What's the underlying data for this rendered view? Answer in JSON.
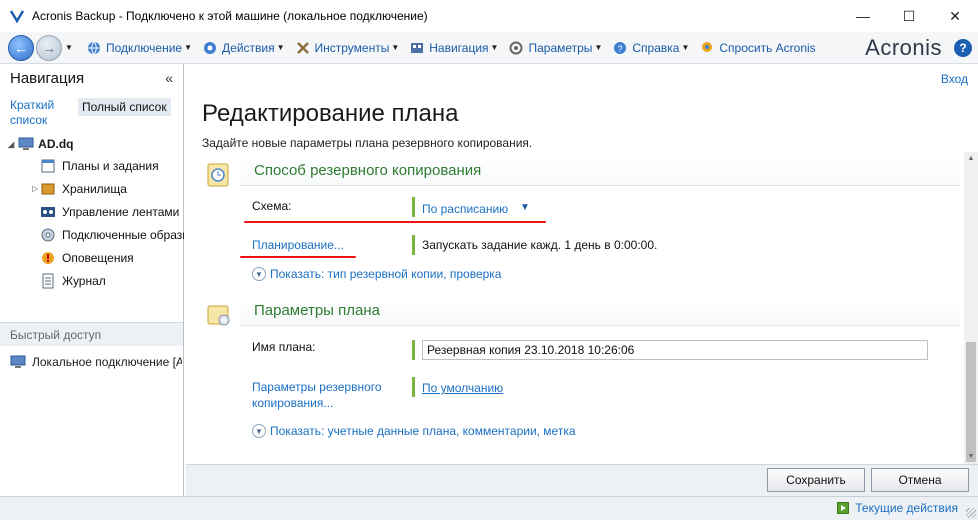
{
  "window": {
    "title": "Acronis Backup - Подключено к этой машине (локальное подключение)",
    "minimize": "—",
    "maximize": "☐",
    "close": "✕"
  },
  "toolbar": {
    "items": [
      {
        "label": "Подключение",
        "icon": "globe-icon"
      },
      {
        "label": "Действия",
        "icon": "gear-icon"
      },
      {
        "label": "Инструменты",
        "icon": "tools-icon"
      },
      {
        "label": "Навигация",
        "icon": "grid-icon"
      },
      {
        "label": "Параметры",
        "icon": "settings-icon"
      },
      {
        "label": "Справка",
        "icon": "help-icon"
      },
      {
        "label": "Спросить Acronis",
        "icon": "ask-icon"
      }
    ],
    "logo": "Acronis",
    "help": "?"
  },
  "navigation": {
    "title": "Навигация",
    "collapse": "«",
    "tab_brief": "Краткий список",
    "tab_full": "Полный список",
    "root": "AD.dq",
    "items": [
      {
        "label": "Планы и задания",
        "icon": "calendar-icon"
      },
      {
        "label": "Хранилища",
        "icon": "storage-icon"
      },
      {
        "label": "Управление лентами",
        "icon": "tape-icon"
      },
      {
        "label": "Подключенные образы",
        "icon": "disk-image-icon"
      },
      {
        "label": "Оповещения",
        "icon": "alert-icon"
      },
      {
        "label": "Журнал",
        "icon": "log-icon"
      }
    ],
    "quick_access_title": "Быстрый доступ",
    "quick_access_item": "Локальное подключение [AD.dq]"
  },
  "main": {
    "exit": "Вход",
    "title": "Редактирование плана",
    "subtitle": "Задайте новые параметры плана резервного копирования.",
    "section_backup": {
      "title": "Способ резервного копирования",
      "scheme_label": "Схема:",
      "scheme_value": "По расписанию",
      "schedule_label": "Планирование...",
      "schedule_value": "Запускать задание кажд. 1 день в 0:00:00.",
      "show_link": "Показать: тип резервной копии, проверка"
    },
    "section_plan": {
      "title": "Параметры плана",
      "name_label": "Имя плана:",
      "name_value": "Резервная копия 23.10.2018 10:26:06",
      "options_label": "Параметры резервного копирования...",
      "options_value": "По умолчанию",
      "show_link": "Показать: учетные данные плана, комментарии, метка"
    }
  },
  "buttons": {
    "save": "Сохранить",
    "cancel": "Отмена"
  },
  "status": {
    "current_actions": "Текущие действия"
  },
  "colors": {
    "link": "#1a6fc2",
    "section_title": "#2e7d32",
    "green_bar": "#7cb342",
    "annotation_red": "#e11111"
  }
}
